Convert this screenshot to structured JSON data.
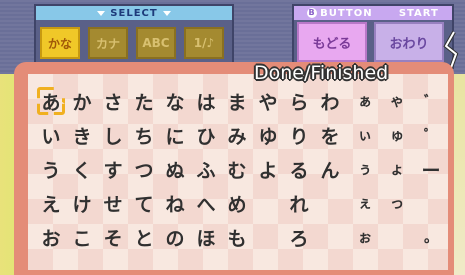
{
  "header": {
    "select_label": "SELECT",
    "button_label": "BUTTON",
    "button_icon": "B",
    "start_label": "START"
  },
  "modes": [
    {
      "label": "かな",
      "active": true
    },
    {
      "label": "カナ",
      "active": false
    },
    {
      "label": "ABC",
      "active": false
    },
    {
      "label": "1/♪",
      "active": false
    }
  ],
  "actions": {
    "back_label": "もどる",
    "done_label": "おわり"
  },
  "caption": "Done/Finished",
  "keys": [
    [
      "あ",
      "か",
      "さ",
      "た",
      "な",
      "は",
      "ま",
      "や",
      "ら",
      "わ",
      "ぁ",
      "ゃ",
      "゛"
    ],
    [
      "い",
      "き",
      "し",
      "ち",
      "に",
      "ひ",
      "み",
      "ゆ",
      "り",
      "を",
      "ぃ",
      "ゅ",
      "゜"
    ],
    [
      "う",
      "く",
      "す",
      "つ",
      "ぬ",
      "ふ",
      "む",
      "よ",
      "る",
      "ん",
      "ぅ",
      "ょ",
      "ー"
    ],
    [
      "え",
      "け",
      "せ",
      "て",
      "ね",
      "へ",
      "め",
      "",
      "れ",
      "",
      "ぇ",
      "っ",
      ""
    ],
    [
      "お",
      "こ",
      "そ",
      "と",
      "の",
      "ほ",
      "も",
      "",
      "ろ",
      "",
      "ぉ",
      "",
      "。"
    ]
  ],
  "selected_key": "あ"
}
